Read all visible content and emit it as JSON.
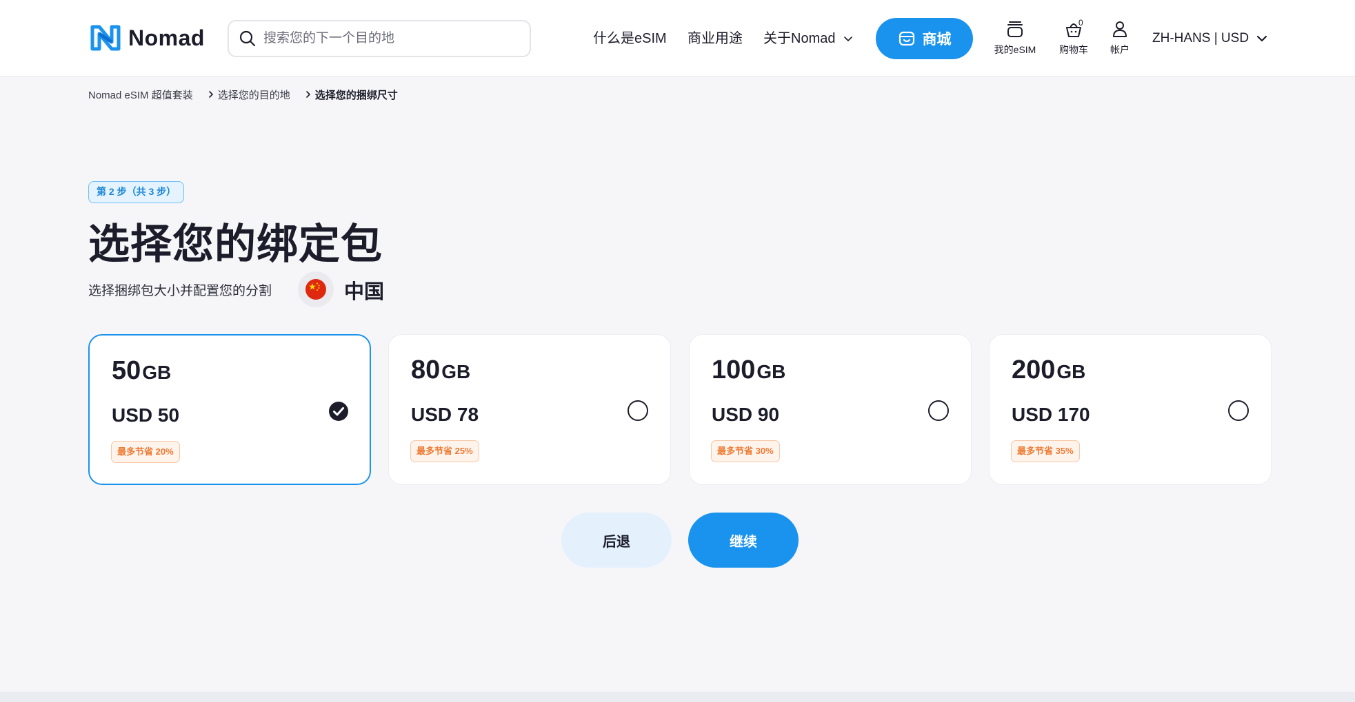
{
  "header": {
    "brand": "Nomad",
    "search": {
      "placeholder": "搜索您的下一个目的地",
      "value": ""
    },
    "nav": [
      {
        "label": "什么是eSIM"
      },
      {
        "label": "商业用途"
      },
      {
        "label": "关于Nomad",
        "has_dropdown": true
      }
    ],
    "shop_label": "商城",
    "icons": {
      "my_esim": "我的eSIM",
      "cart": "购物车",
      "cart_count": "0",
      "account": "帐户"
    },
    "locale": "ZH-HANS | USD"
  },
  "breadcrumb": [
    "Nomad eSIM 超值套装",
    "选择您的目的地",
    "选择您的捆绑尺寸"
  ],
  "main": {
    "step_badge": "第 2 步（共 3 步）",
    "title": "选择您的绑定包",
    "subtitle": "选择捆绑包大小并配置您的分割",
    "country": "中国",
    "plans": [
      {
        "size": "50",
        "unit": "GB",
        "price": "USD 50",
        "save": "最多节省 20%",
        "selected": true
      },
      {
        "size": "80",
        "unit": "GB",
        "price": "USD 78",
        "save": "最多节省 25%",
        "selected": false
      },
      {
        "size": "100",
        "unit": "GB",
        "price": "USD 90",
        "save": "最多节省 30%",
        "selected": false
      },
      {
        "size": "200",
        "unit": "GB",
        "price": "USD 170",
        "save": "最多节省 35%",
        "selected": false
      }
    ],
    "back_label": "后退",
    "continue_label": "继续"
  },
  "colors": {
    "accent": "#1a93ee",
    "save_text": "#ef7a33",
    "badge_text": "#1a86d8",
    "background": "#f6f6f9"
  }
}
